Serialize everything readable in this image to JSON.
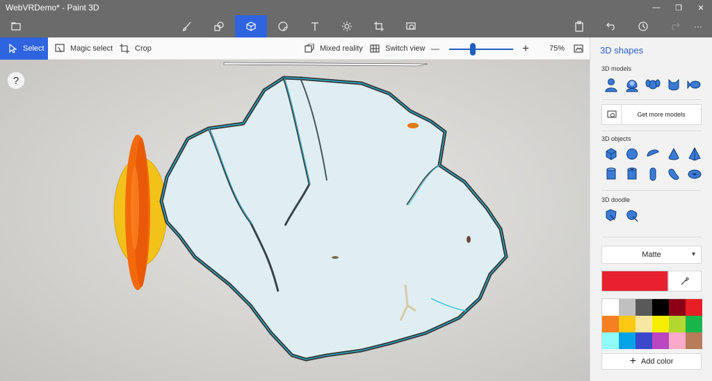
{
  "window": {
    "title": "WebVRDemo* - Paint 3D",
    "minimize_glyph": "—",
    "maximize_glyph": "❐",
    "close_glyph": "✕"
  },
  "main_toolbar": {
    "tools": [
      "brushes-icon",
      "2d-shapes-icon",
      "3d-shapes-icon",
      "stickers-icon",
      "text-icon",
      "effects-icon",
      "canvas-icon",
      "remix3d-icon"
    ],
    "active_tool": "3d-shapes-icon",
    "more_glyph": "···"
  },
  "sub_toolbar": {
    "select": "Select",
    "magic_select": "Magic select",
    "crop": "Crop",
    "mixed_reality": "Mixed reality",
    "switch_view": "Switch view",
    "zoom_minus": "—",
    "zoom_plus": "+",
    "zoom_level": "75%"
  },
  "canvas": {
    "help": "?"
  },
  "panel": {
    "title": "3D shapes",
    "models_label": "3D models",
    "get_more_models": "Get more models",
    "objects_label": "3D objects",
    "doodle_label": "3D doodle",
    "finish": "Matte",
    "add_color": "Add color",
    "accent_color": "#2f64e0",
    "selected_color": "#e8202f",
    "palette": [
      "#ffffff",
      "#c0c0c0",
      "#595959",
      "#000000",
      "#8b0016",
      "#e81e25",
      "#f58021",
      "#fcc812",
      "#f7e7a1",
      "#f6ee02",
      "#b2d730",
      "#18b54a",
      "#8ffcfa",
      "#04a3e8",
      "#3c48cc",
      "#b847c0",
      "#f9aac9",
      "#b87c5a"
    ]
  }
}
